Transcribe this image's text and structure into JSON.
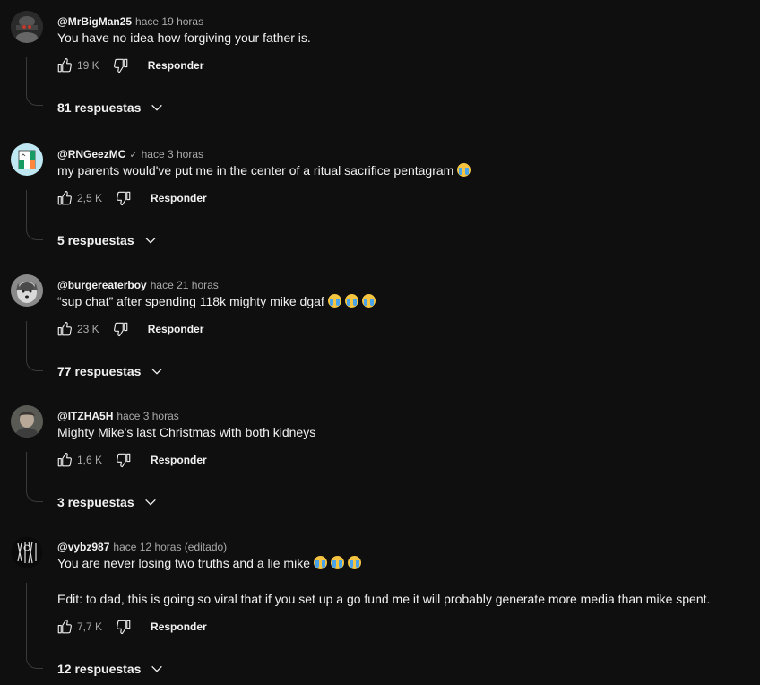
{
  "comments": [
    {
      "author": "@MrBigMan25",
      "verified": false,
      "time": "hace 19 horas",
      "text_lines": [
        "You have no idea how forgiving your father is."
      ],
      "likes": "19 K",
      "reply_label": "Responder",
      "replies_label": "81 respuestas",
      "avatar_icon": "avatar-dark-figure"
    },
    {
      "author": "@RNGeezMC",
      "verified": true,
      "time": "hace 3 horas",
      "text_lines": [
        "my parents would've put me in the center of a ritual sacrifice pentagram"
      ],
      "emoji_count": 1,
      "likes": "2,5 K",
      "reply_label": "Responder",
      "replies_label": "5 respuestas",
      "avatar_icon": "avatar-irish-flag-cartoon"
    },
    {
      "author": "@burgereaterboy",
      "verified": false,
      "time": "hace 21 horas",
      "text_lines": [
        "“sup chat” after spending 118k mighty mike dgaf"
      ],
      "emoji_count": 3,
      "likes": "23 K",
      "reply_label": "Responder",
      "replies_label": "77 respuestas",
      "avatar_icon": "avatar-husky-dog"
    },
    {
      "author": "@ITZHA5H",
      "verified": false,
      "time": "hace 3 horas",
      "text_lines": [
        "Mighty Mike's last Christmas with both kidneys"
      ],
      "likes": "1,6 K",
      "reply_label": "Responder",
      "replies_label": "3 respuestas",
      "avatar_icon": "avatar-photo-person"
    },
    {
      "author": "@vybz987",
      "verified": false,
      "time": "hace 12 horas (editado)",
      "text_lines": [
        "You are never losing two truths and a lie mike",
        "Edit: to dad, this is going so viral that if you set up a go fund me it will probably generate more media than mike spent."
      ],
      "emoji_count": 3,
      "likes": "7,7 K",
      "reply_label": "Responder",
      "replies_label": "12 respuestas",
      "avatar_icon": "avatar-black-white-artwork"
    }
  ],
  "icons": {
    "like": "thumb-up-icon",
    "dislike": "thumb-down-icon",
    "expand": "chevron-down-icon",
    "emoji": "loudly-crying-face-emoji"
  },
  "colors": {
    "background": "#0f0f0f",
    "text_primary": "#f1f1f1",
    "text_secondary": "#aaaaaa",
    "thread_line": "#3a3a3a"
  }
}
